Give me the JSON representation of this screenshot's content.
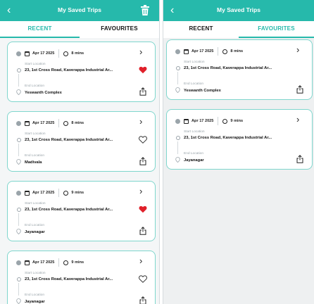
{
  "colors": {
    "accent": "#26b9ab",
    "heart": "#e0202a"
  },
  "left": {
    "header": {
      "title": "My Saved Trips"
    },
    "tabs": [
      {
        "label": "RECENT",
        "active": true
      },
      {
        "label": "FAVOURITES",
        "active": false
      }
    ],
    "cards": [
      {
        "date": "Apr 17 2025",
        "duration": "8 mins",
        "start_label": "Start Location",
        "start": "23, 1st Cross Road, Kaverappa Industrial Ar...",
        "end_label": "End Location",
        "end": "Yeswanth Complex",
        "favourite": true
      },
      {
        "date": "Apr 17 2025",
        "duration": "8 mins",
        "start_label": "Start Location",
        "start": "23, 1st Cross Road, Kaverappa Industrial Ar...",
        "end_label": "End Location",
        "end": "Madivala",
        "favourite": false
      },
      {
        "date": "Apr 17 2025",
        "duration": "9 mins",
        "start_label": "Start Location",
        "start": "23, 1st Cross Road, Kaverappa Industrial Ar...",
        "end_label": "End Location",
        "end": "Jayanagar",
        "favourite": true
      },
      {
        "date": "Apr 17 2025",
        "duration": "9 mins",
        "start_label": "Start Location",
        "start": "23, 1st Cross Road, Kaverappa Industrial Ar...",
        "end_label": "End Location",
        "end": "Jayanagar",
        "favourite": false
      }
    ]
  },
  "right": {
    "header": {
      "title": "My Saved Trips"
    },
    "tabs": [
      {
        "label": "RECENT",
        "active": false
      },
      {
        "label": "FAVOURITES",
        "active": true
      }
    ],
    "cards": [
      {
        "date": "Apr 17 2025",
        "duration": "8 mins",
        "start_label": "Start Location",
        "start": "23, 1st Cross Road, Kaverappa Industrial Ar...",
        "end_label": "End Location",
        "end": "Yeswanth Complex"
      },
      {
        "date": "Apr 17 2025",
        "duration": "9 mins",
        "start_label": "Start Location",
        "start": "23, 1st Cross Road, Kaverappa Industrial Ar...",
        "end_label": "End Location",
        "end": "Jayanagar"
      }
    ]
  }
}
